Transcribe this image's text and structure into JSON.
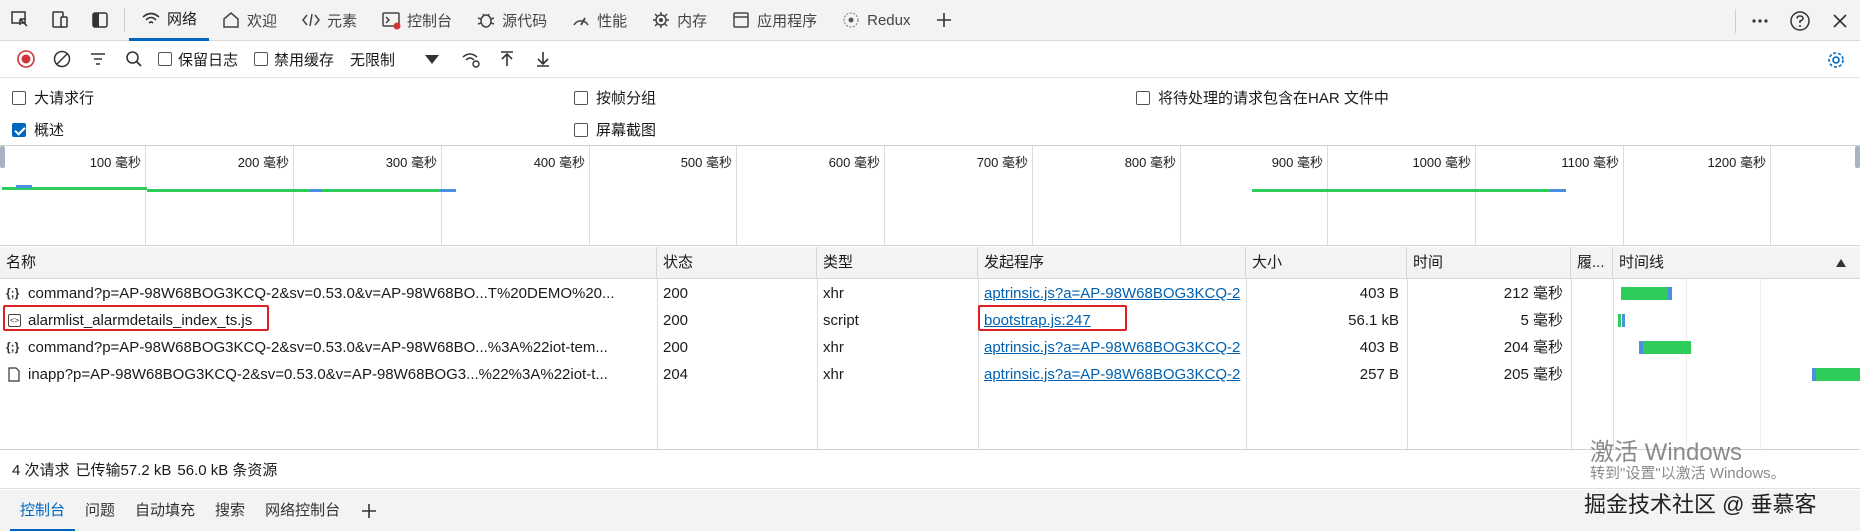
{
  "topbar": {
    "tabs": [
      {
        "label": "网络",
        "icon": "wifi-icon",
        "active": true
      },
      {
        "label": "欢迎",
        "icon": "home-icon"
      },
      {
        "label": "元素",
        "icon": "code-icon"
      },
      {
        "label": "控制台",
        "icon": "console-icon"
      },
      {
        "label": "源代码",
        "icon": "bug-icon"
      },
      {
        "label": "性能",
        "icon": "performance-icon"
      },
      {
        "label": "内存",
        "icon": "memory-icon"
      },
      {
        "label": "应用程序",
        "icon": "application-icon"
      },
      {
        "label": "Redux",
        "icon": "redux-icon"
      }
    ]
  },
  "toolbar": {
    "preserve_log": "保留日志",
    "disable_cache": "禁用缓存",
    "throttle": "无限制"
  },
  "options": {
    "large_rows": "大请求行",
    "group_by_frame": "按帧分组",
    "har_pending": "将待处理的请求包含在HAR 文件中",
    "overview": "概述",
    "screenshots": "屏幕截图"
  },
  "overview": {
    "ticks": [
      "100 毫秒",
      "200 毫秒",
      "300 毫秒",
      "400 毫秒",
      "500 毫秒",
      "600 毫秒",
      "700 毫秒",
      "800 毫秒",
      "900 毫秒",
      "1000 毫秒",
      "1100 毫秒",
      "1200 毫秒"
    ]
  },
  "table": {
    "headers": {
      "name": "名称",
      "status": "状态",
      "type": "类型",
      "initiator": "发起程序",
      "size": "大小",
      "time": "时间",
      "fulfilled": "履...",
      "waterfall": "时间线"
    },
    "rows": [
      {
        "name": "command?p=AP-98W68BOG3KCQ-2&sv=0.53.0&v=AP-98W68BO...T%20DEMO%20...",
        "status": "200",
        "type": "xhr",
        "initiator": "aptrinsic.js?a=AP-98W68BOG3KCQ-2",
        "size": "403 B",
        "time": "212 毫秒",
        "icon": "json-icon"
      },
      {
        "name": "alarmlist_alarmdetails_index_ts.js",
        "status": "200",
        "type": "script",
        "initiator": "bootstrap.js:247",
        "size": "56.1 kB",
        "time": "5 毫秒",
        "icon": "script-icon"
      },
      {
        "name": "command?p=AP-98W68BOG3KCQ-2&sv=0.53.0&v=AP-98W68BO...%3A%22iot-tem...",
        "status": "200",
        "type": "xhr",
        "initiator": "aptrinsic.js?a=AP-98W68BOG3KCQ-2",
        "size": "403 B",
        "time": "204 毫秒",
        "icon": "json-icon"
      },
      {
        "name": "inapp?p=AP-98W68BOG3KCQ-2&sv=0.53.0&v=AP-98W68BOG3...%22%3A%22iot-t...",
        "status": "204",
        "type": "xhr",
        "initiator": "aptrinsic.js?a=AP-98W68BOG3KCQ-2",
        "size": "257 B",
        "time": "205 毫秒",
        "icon": "document-icon"
      }
    ]
  },
  "status": {
    "requests": "4 次请求",
    "transferred": "已传输57.2 kB",
    "resources": "56.0 kB 条资源"
  },
  "drawer": {
    "tabs": [
      "控制台",
      "问题",
      "自动填充",
      "搜索",
      "网络控制台"
    ]
  },
  "watermark": {
    "title": "激活 Windows",
    "subtitle": "转到\"设置\"以激活 Windows。",
    "brand": "掘金技术社区 @ 垂慕客"
  },
  "colors": {
    "accent": "#0067c0",
    "link": "#0060b0",
    "highlight": "#e02020",
    "waterfall_green": "#2ecc5a",
    "waterfall_blue": "#4a90e2"
  }
}
